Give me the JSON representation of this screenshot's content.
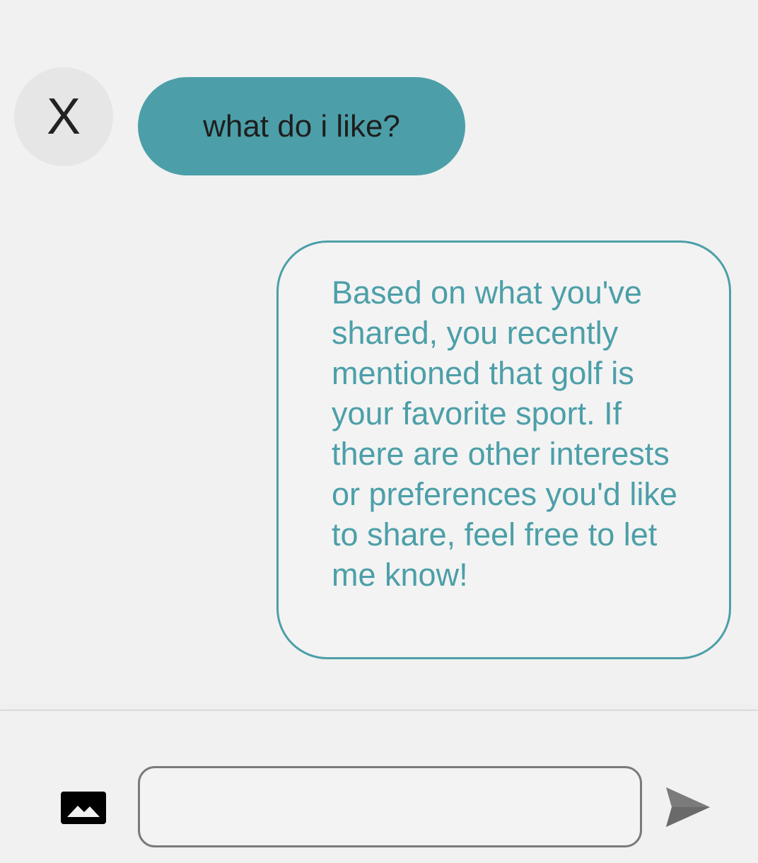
{
  "conversation": {
    "user_avatar_letter": "X",
    "user_message": "what do i like?",
    "bot_message": "Based on what you've shared, you recently mentioned that golf is your favorite sport. If there are other interests or preferences you'd like to share, feel free to let me know!"
  },
  "composer": {
    "input_value": "",
    "input_placeholder": "",
    "image_icon": "image-icon",
    "send_icon": "send-icon"
  },
  "colors": {
    "accent": "#4c9fa8",
    "background": "#f1f1f1"
  }
}
